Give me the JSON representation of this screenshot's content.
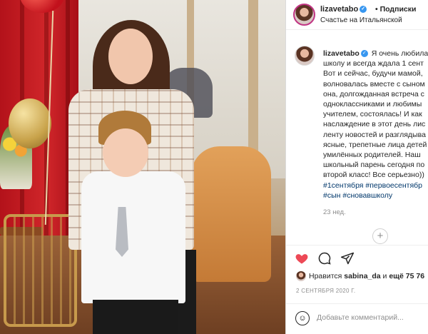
{
  "header": {
    "username": "lizavetabo",
    "verified_mark": "✓",
    "separator": "•",
    "follow_label": "Подписки",
    "location": "Счастье на Итальянской"
  },
  "caption": {
    "username": "lizavetabo",
    "lines": [
      "Я очень любила",
      "школу и всегда ждала 1 сент",
      "Вот и сейчас, будучи мамой,",
      "волновалась вместе с сыном",
      "она, долгожданная встреча с",
      "одноклассниками и любимы",
      "учителем, состоялась! И как",
      "наслаждение в этот день лис",
      "ленту новостей и разглядыва",
      "ясные, трепетные лица детей",
      "умилённых родителей. Наш",
      "школьный парень сегодня по",
      "второй класс! Все серьезно))"
    ],
    "hashtags_line1": "#1сентября #первоесентябр",
    "hashtags_line2": "#сын #сновавшколу",
    "time_ago": "23 нед."
  },
  "actions": {
    "like_icon": "heart-icon",
    "comment_icon": "comment-icon",
    "share_icon": "share-icon",
    "like_color": "#ed4956"
  },
  "likes": {
    "prefix": "Нравится",
    "user": "sabina_da",
    "middle": "и",
    "count": "ещё 75 76"
  },
  "date": "2 СЕНТЯБРЯ 2020 Г.",
  "comment": {
    "placeholder": "Добавьте комментарий..."
  }
}
